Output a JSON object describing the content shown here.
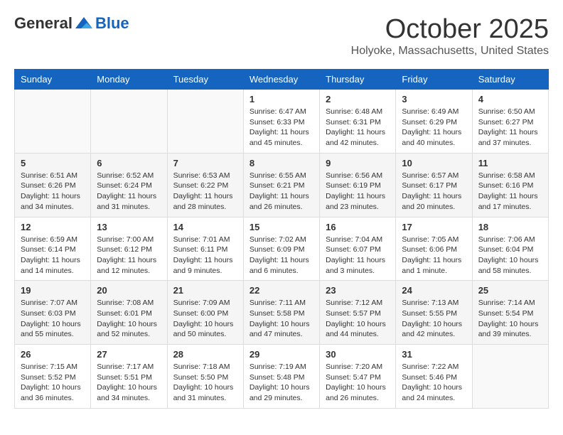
{
  "header": {
    "logo": {
      "general": "General",
      "blue": "Blue"
    },
    "title": "October 2025",
    "location": "Holyoke, Massachusetts, United States"
  },
  "days_of_week": [
    "Sunday",
    "Monday",
    "Tuesday",
    "Wednesday",
    "Thursday",
    "Friday",
    "Saturday"
  ],
  "weeks": [
    [
      {
        "day": "",
        "info": ""
      },
      {
        "day": "",
        "info": ""
      },
      {
        "day": "",
        "info": ""
      },
      {
        "day": "1",
        "info": "Sunrise: 6:47 AM\nSunset: 6:33 PM\nDaylight: 11 hours and 45 minutes."
      },
      {
        "day": "2",
        "info": "Sunrise: 6:48 AM\nSunset: 6:31 PM\nDaylight: 11 hours and 42 minutes."
      },
      {
        "day": "3",
        "info": "Sunrise: 6:49 AM\nSunset: 6:29 PM\nDaylight: 11 hours and 40 minutes."
      },
      {
        "day": "4",
        "info": "Sunrise: 6:50 AM\nSunset: 6:27 PM\nDaylight: 11 hours and 37 minutes."
      }
    ],
    [
      {
        "day": "5",
        "info": "Sunrise: 6:51 AM\nSunset: 6:26 PM\nDaylight: 11 hours and 34 minutes."
      },
      {
        "day": "6",
        "info": "Sunrise: 6:52 AM\nSunset: 6:24 PM\nDaylight: 11 hours and 31 minutes."
      },
      {
        "day": "7",
        "info": "Sunrise: 6:53 AM\nSunset: 6:22 PM\nDaylight: 11 hours and 28 minutes."
      },
      {
        "day": "8",
        "info": "Sunrise: 6:55 AM\nSunset: 6:21 PM\nDaylight: 11 hours and 26 minutes."
      },
      {
        "day": "9",
        "info": "Sunrise: 6:56 AM\nSunset: 6:19 PM\nDaylight: 11 hours and 23 minutes."
      },
      {
        "day": "10",
        "info": "Sunrise: 6:57 AM\nSunset: 6:17 PM\nDaylight: 11 hours and 20 minutes."
      },
      {
        "day": "11",
        "info": "Sunrise: 6:58 AM\nSunset: 6:16 PM\nDaylight: 11 hours and 17 minutes."
      }
    ],
    [
      {
        "day": "12",
        "info": "Sunrise: 6:59 AM\nSunset: 6:14 PM\nDaylight: 11 hours and 14 minutes."
      },
      {
        "day": "13",
        "info": "Sunrise: 7:00 AM\nSunset: 6:12 PM\nDaylight: 11 hours and 12 minutes."
      },
      {
        "day": "14",
        "info": "Sunrise: 7:01 AM\nSunset: 6:11 PM\nDaylight: 11 hours and 9 minutes."
      },
      {
        "day": "15",
        "info": "Sunrise: 7:02 AM\nSunset: 6:09 PM\nDaylight: 11 hours and 6 minutes."
      },
      {
        "day": "16",
        "info": "Sunrise: 7:04 AM\nSunset: 6:07 PM\nDaylight: 11 hours and 3 minutes."
      },
      {
        "day": "17",
        "info": "Sunrise: 7:05 AM\nSunset: 6:06 PM\nDaylight: 11 hours and 1 minute."
      },
      {
        "day": "18",
        "info": "Sunrise: 7:06 AM\nSunset: 6:04 PM\nDaylight: 10 hours and 58 minutes."
      }
    ],
    [
      {
        "day": "19",
        "info": "Sunrise: 7:07 AM\nSunset: 6:03 PM\nDaylight: 10 hours and 55 minutes."
      },
      {
        "day": "20",
        "info": "Sunrise: 7:08 AM\nSunset: 6:01 PM\nDaylight: 10 hours and 52 minutes."
      },
      {
        "day": "21",
        "info": "Sunrise: 7:09 AM\nSunset: 6:00 PM\nDaylight: 10 hours and 50 minutes."
      },
      {
        "day": "22",
        "info": "Sunrise: 7:11 AM\nSunset: 5:58 PM\nDaylight: 10 hours and 47 minutes."
      },
      {
        "day": "23",
        "info": "Sunrise: 7:12 AM\nSunset: 5:57 PM\nDaylight: 10 hours and 44 minutes."
      },
      {
        "day": "24",
        "info": "Sunrise: 7:13 AM\nSunset: 5:55 PM\nDaylight: 10 hours and 42 minutes."
      },
      {
        "day": "25",
        "info": "Sunrise: 7:14 AM\nSunset: 5:54 PM\nDaylight: 10 hours and 39 minutes."
      }
    ],
    [
      {
        "day": "26",
        "info": "Sunrise: 7:15 AM\nSunset: 5:52 PM\nDaylight: 10 hours and 36 minutes."
      },
      {
        "day": "27",
        "info": "Sunrise: 7:17 AM\nSunset: 5:51 PM\nDaylight: 10 hours and 34 minutes."
      },
      {
        "day": "28",
        "info": "Sunrise: 7:18 AM\nSunset: 5:50 PM\nDaylight: 10 hours and 31 minutes."
      },
      {
        "day": "29",
        "info": "Sunrise: 7:19 AM\nSunset: 5:48 PM\nDaylight: 10 hours and 29 minutes."
      },
      {
        "day": "30",
        "info": "Sunrise: 7:20 AM\nSunset: 5:47 PM\nDaylight: 10 hours and 26 minutes."
      },
      {
        "day": "31",
        "info": "Sunrise: 7:22 AM\nSunset: 5:46 PM\nDaylight: 10 hours and 24 minutes."
      },
      {
        "day": "",
        "info": ""
      }
    ]
  ]
}
